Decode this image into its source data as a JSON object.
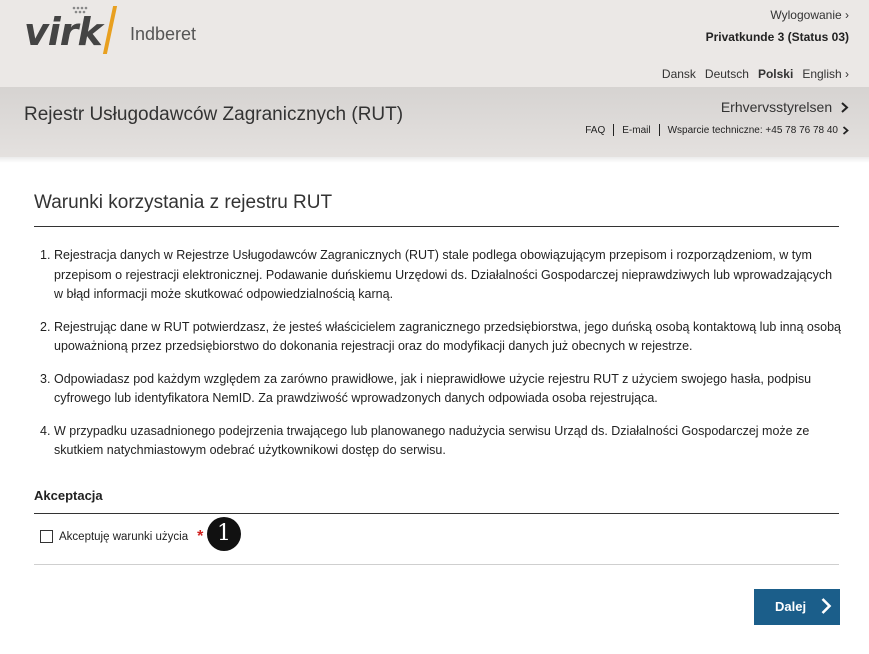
{
  "brand": {
    "name": "virk",
    "product": "Indberet",
    "accent_color": "#e8a020"
  },
  "header": {
    "logout_label": "Wylogowanie ›",
    "user_label": "Privatkunde 3 (Status 03)",
    "languages": [
      "Dansk",
      "Deutsch",
      "Polski",
      "English ›"
    ],
    "active_language": "Polski"
  },
  "banner": {
    "title": "Rejestr Usługodawców Zagranicznych (RUT)",
    "agency_label": "Erhvervsstyrelsen",
    "faq_label": "FAQ",
    "email_label": "E-mail",
    "support_label": "Wsparcie techniczne: +45 78 76 78 40"
  },
  "content": {
    "title": "Warunki korzystania z rejestru RUT",
    "terms": [
      {
        "num": "1.",
        "text": "Rejestracja danych w Rejestrze Usługodawców Zagranicznych (RUT) stale podlega obowiązującym przepisom i rozporządzeniom, w tym przepisom o rejestracji elektronicznej. Podawanie duńskiemu Urzędowi ds. Działalności Gospodarczej nieprawdziwych lub wprowadzających w błąd informacji może skutkować odpowiedzialnością karną."
      },
      {
        "num": "2.",
        "text": "Rejestrując dane w RUT potwierdzasz, że jesteś właścicielem zagranicznego przedsiębiorstwa, jego duńską osobą kontaktową lub inną osobą upoważnioną przez przedsiębiorstwo do dokonania rejestracji oraz do modyfikacji danych już obecnych w rejestrze."
      },
      {
        "num": "3.",
        "text": "Odpowiadasz pod każdym względem za zarówno prawidłowe, jak i nieprawidłowe użycie rejestru RUT z użyciem swojego hasła, podpisu cyfrowego lub identyfikatora NemID. Za prawdziwość wprowadzonych danych odpowiada osoba rejestrująca."
      },
      {
        "num": "4.",
        "text": "W przypadku uzasadnionego podejrzenia trwającego lub planowanego nadużycia serwisu Urząd ds. Działalności Gospodarczej może ze skutkiem natychmiastowym odebrać użytkownikowi dostęp do serwisu."
      }
    ],
    "acceptance_title": "Akceptacja",
    "accept_label": "Akceptuję warunki użycia",
    "required_mark": "*",
    "accept_checked": false,
    "badge_number": "1",
    "next_button_label": "Dalej",
    "button_color": "#1b5e8a",
    "required_color": "#d0201e"
  }
}
